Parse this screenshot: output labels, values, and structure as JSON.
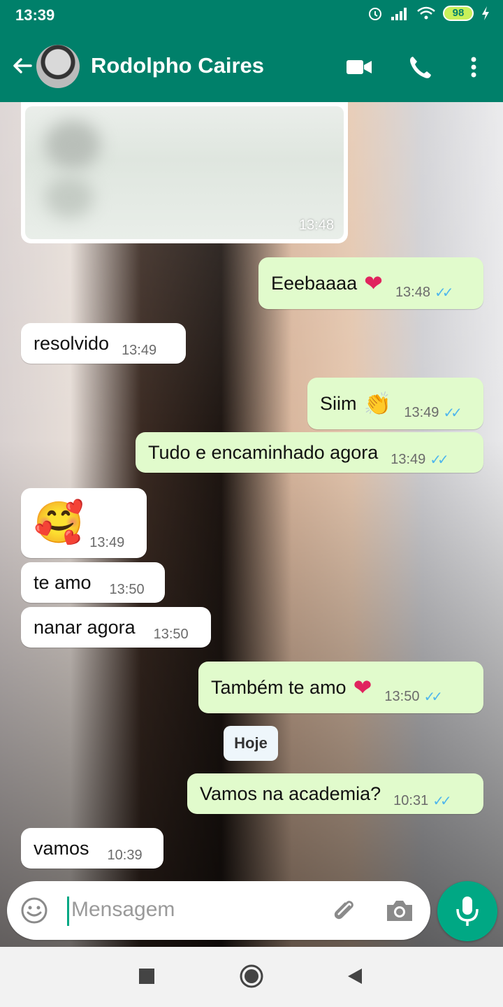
{
  "status": {
    "time": "13:39",
    "battery": "98"
  },
  "header": {
    "contact_name": "Rodolpho Caires"
  },
  "messages": {
    "media_time": "13:48",
    "m1": {
      "text": "Eeebaaaa",
      "time": "13:48"
    },
    "m2": {
      "text": "resolvido",
      "time": "13:49"
    },
    "m3": {
      "text": "Siim",
      "time": "13:49"
    },
    "m4": {
      "text": "Tudo e encaminhado agora",
      "time": "13:49"
    },
    "m5": {
      "emoji": "🥰",
      "time": "13:49"
    },
    "m6": {
      "text": "te amo",
      "time": "13:50"
    },
    "m7": {
      "text": "nanar agora",
      "time": "13:50"
    },
    "m8": {
      "text": "Também te amo",
      "time": "13:50"
    },
    "day_separator": "Hoje",
    "m9": {
      "text": "Vamos na academia?",
      "time": "10:31"
    },
    "m10": {
      "text": "vamos",
      "time": "10:39"
    }
  },
  "composer": {
    "placeholder": "Mensagem"
  },
  "icons": {
    "back": "arrow-left-icon",
    "video": "video-call-icon",
    "call": "phone-icon",
    "more": "more-vert-icon",
    "emoji": "emoji-icon",
    "attach": "paperclip-icon",
    "camera": "camera-icon",
    "mic": "mic-icon",
    "heart": "red-heart-emoji",
    "clap": "clapping-hands-emoji",
    "read": "double-check-icon"
  },
  "colors": {
    "header": "#00806a",
    "outgoing_bubble": "#e1fbcc",
    "incoming_bubble": "#ffffff",
    "accent": "#00a884",
    "read_ticks": "#4fb6ec"
  }
}
